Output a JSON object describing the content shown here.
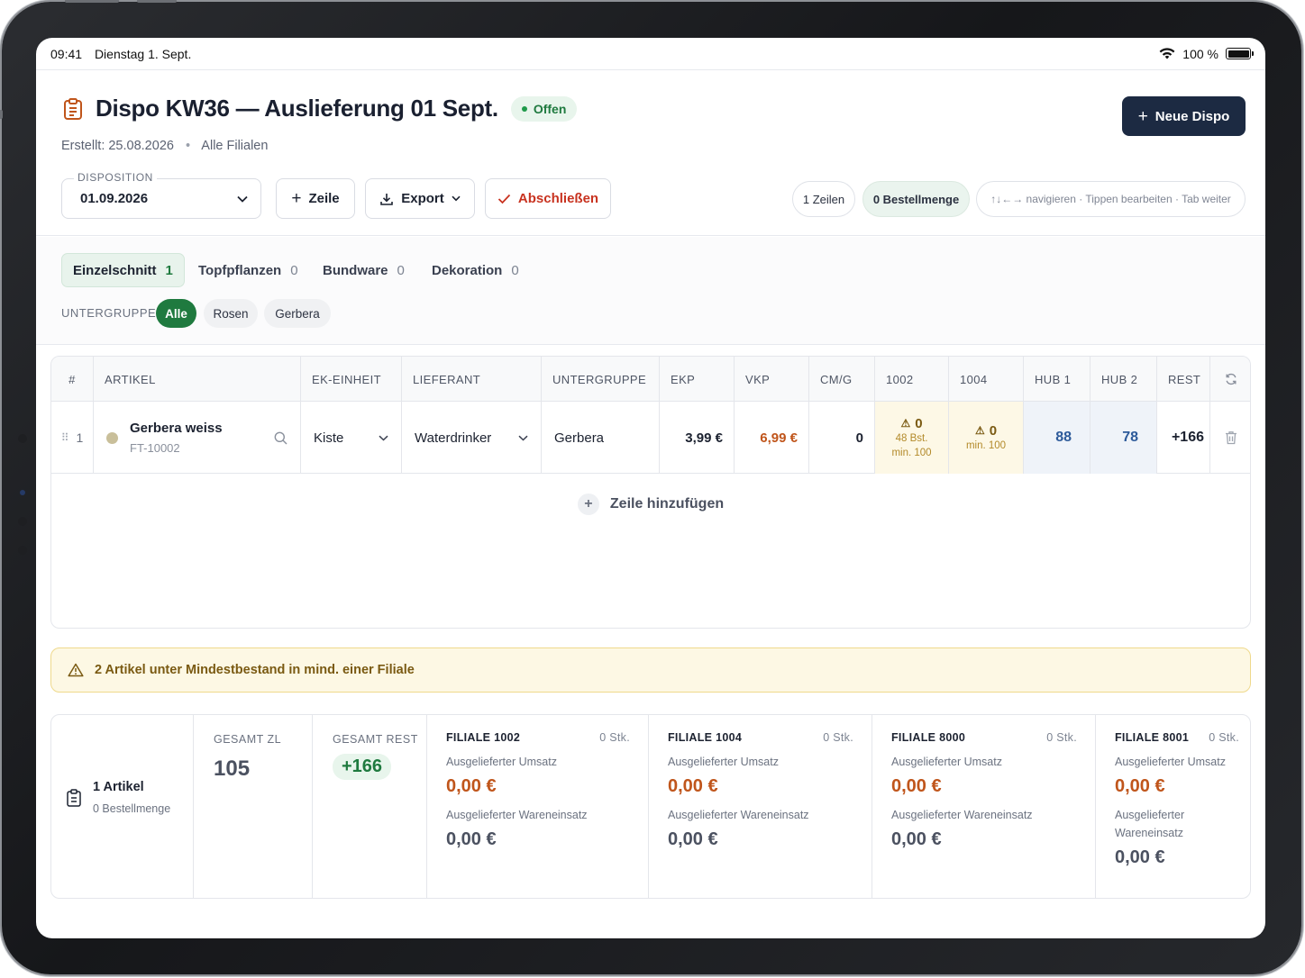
{
  "status_bar": {
    "time": "09:41",
    "date": "Dienstag 1. Sept.",
    "battery": "100 %"
  },
  "header": {
    "title": "Dispo KW36 — Auslieferung 01 Sept.",
    "status_badge": "Offen",
    "created": "Erstellt: 25.08.2026",
    "scope": "Alle Filialen",
    "new_button": "Neue Dispo"
  },
  "toolbar": {
    "disposition_label": "DISPOSITION",
    "disposition_value": "01.09.2026",
    "add_row_label": "Zeile",
    "export_label": "Export",
    "close_label": "Abschließen",
    "rows_pill": "1 Zeilen",
    "order_pill": "0 Bestellmenge",
    "hint_pill": "↑↓←→ navigieren · Tippen bearbeiten · Tab weiter"
  },
  "tabs": [
    {
      "label": "Einzelschnitt",
      "count": "1"
    },
    {
      "label": "Topfpflanzen",
      "count": "0"
    },
    {
      "label": "Bundware",
      "count": "0"
    },
    {
      "label": "Dekoration",
      "count": "0"
    }
  ],
  "subgroup": {
    "label": "UNTERGRUPPE",
    "chips": [
      "Alle",
      "Rosen",
      "Gerbera"
    ]
  },
  "table": {
    "columns": [
      "#",
      "ARTIKEL",
      "EK-EINHEIT",
      "LIEFERANT",
      "UNTERGRUPPE",
      "EKP",
      "VKP",
      "CM/G",
      "1002",
      "1004",
      "HUB 1",
      "HUB 2",
      "REST"
    ],
    "row": {
      "index": "1",
      "article_name": "Gerbera weiss",
      "article_sku": "FT-10002",
      "unit": "Kiste",
      "supplier": "Waterdrinker",
      "subgroup": "Gerbera",
      "ekp": "3,99 €",
      "vkp": "6,99 €",
      "cmg": "0",
      "s1002_value": "0",
      "s1002_stock": "48 Bst.",
      "s1002_min": "min. 100",
      "s1004_value": "0",
      "s1004_min": "min. 100",
      "hub1": "88",
      "hub2": "78",
      "rest": "+166"
    },
    "add_row": "Zeile hinzufügen"
  },
  "warning": "2 Artikel unter Mindestbestand in mind. einer Filiale",
  "summary": {
    "articles": "1 Artikel",
    "order_qty": "0 Bestellmenge",
    "total_zl_label": "GESAMT ZL",
    "total_zl": "105",
    "total_rest_label": "GESAMT REST",
    "total_rest": "+166",
    "revenue_label": "Ausgelieferter Umsatz",
    "goods_label": "Ausgelieferter Wareneinsatz",
    "goods_label_a": "Ausgelieferter",
    "goods_label_b": "Wareneinsatz",
    "branches": [
      {
        "name": "FILIALE 1002",
        "stk": "0 Stk.",
        "revenue": "0,00 €",
        "goods": "0,00 €"
      },
      {
        "name": "FILIALE 1004",
        "stk": "0 Stk.",
        "revenue": "0,00 €",
        "goods": "0,00 €"
      },
      {
        "name": "FILIALE 8000",
        "stk": "0 Stk.",
        "revenue": "0,00 €",
        "goods": "0,00 €"
      },
      {
        "name": "FILIALE 8001",
        "stk": "0 Stk.",
        "revenue": "0,00 €",
        "goods": "0,00 €"
      }
    ]
  },
  "colors": {
    "primary_dark": "#1c2a42",
    "accent_green": "#1f7a3f",
    "danger_red": "#c8321f",
    "amount_orange": "#c0551b",
    "warning_bg": "#fdf8e4",
    "hub_blue": "#2d5a9a"
  }
}
